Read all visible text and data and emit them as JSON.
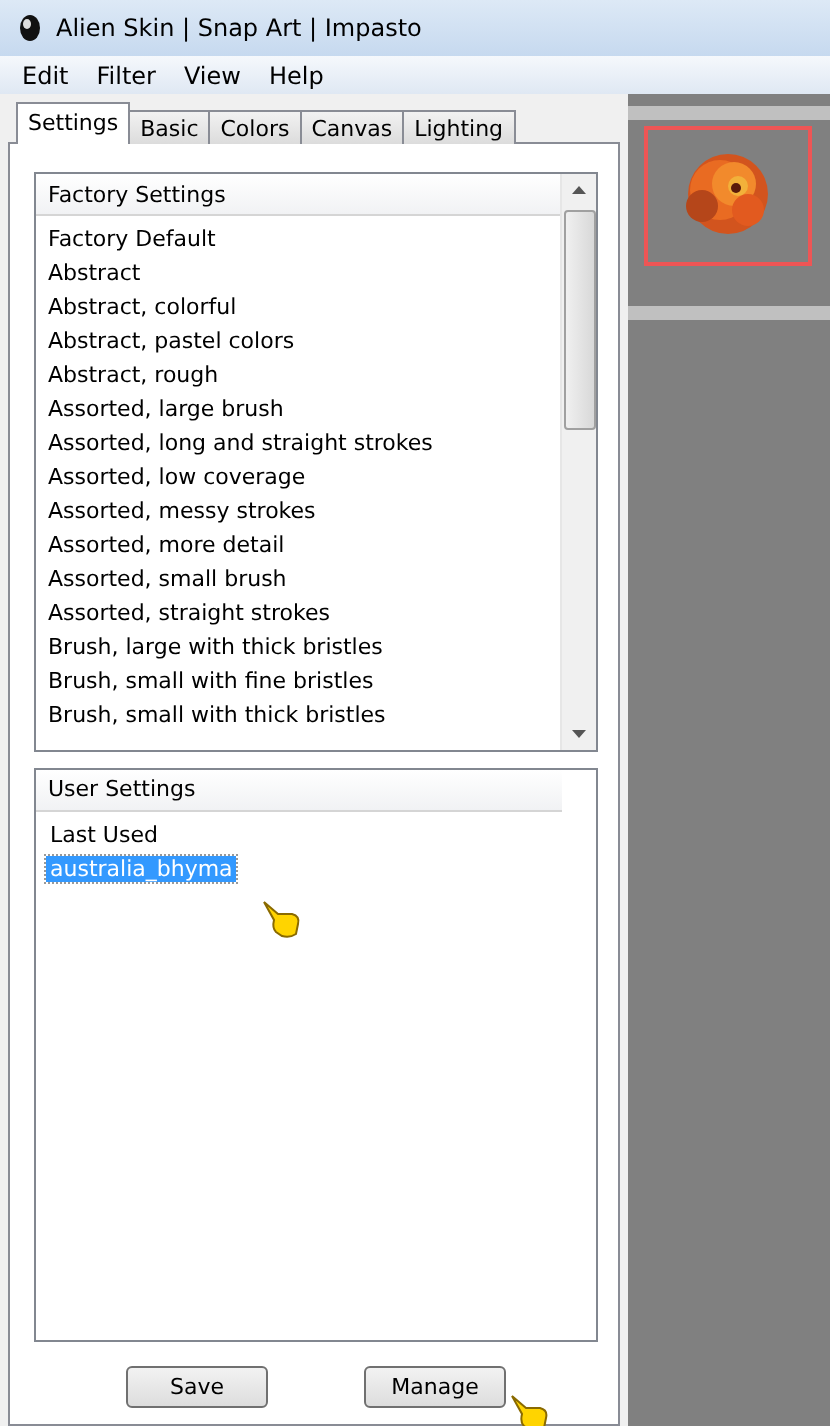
{
  "window": {
    "title": "Alien Skin | Snap Art | Impasto"
  },
  "menu": [
    "Edit",
    "Filter",
    "View",
    "Help"
  ],
  "tabs": [
    {
      "label": "Settings",
      "selected": true
    },
    {
      "label": "Basic",
      "selected": false
    },
    {
      "label": "Colors",
      "selected": false
    },
    {
      "label": "Canvas",
      "selected": false
    },
    {
      "label": "Lighting",
      "selected": false
    }
  ],
  "factory_settings": {
    "header": "Factory Settings",
    "items": [
      "Factory Default",
      "Abstract",
      "Abstract, colorful",
      "Abstract, pastel colors",
      "Abstract, rough",
      "Assorted, large brush",
      "Assorted, long and straight strokes",
      "Assorted, low coverage",
      "Assorted, messy strokes",
      "Assorted, more detail",
      "Assorted, small brush",
      "Assorted, straight strokes",
      "Brush, large with thick bristles",
      "Brush, small with fine bristles",
      "Brush, small with thick bristles"
    ]
  },
  "user_settings": {
    "header": "User Settings",
    "items": [
      {
        "label": "Last Used",
        "selected": false
      },
      {
        "label": "australia_bhyma",
        "selected": true
      }
    ]
  },
  "buttons": [
    "Save",
    "Manage"
  ]
}
